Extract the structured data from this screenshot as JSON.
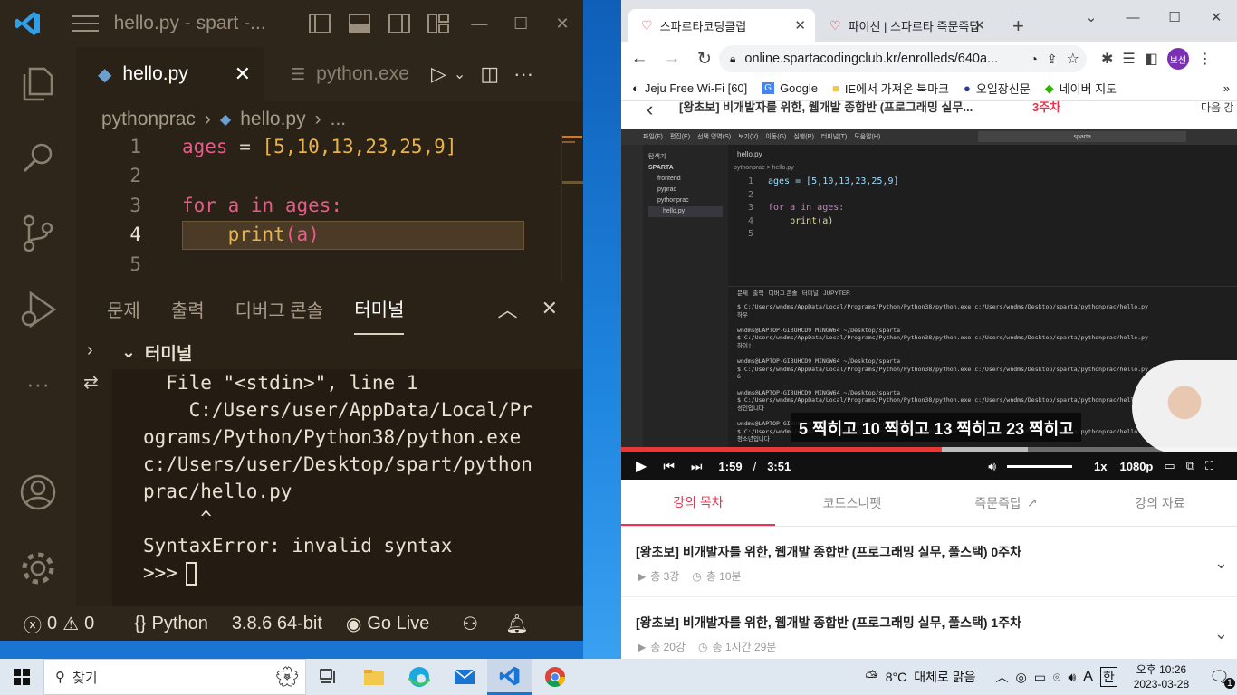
{
  "vscode": {
    "title": "hello.py - spart -...",
    "tabs": {
      "active": "hello.py",
      "inactive": "python.exe"
    },
    "breadcrumb": {
      "folder": "pythonprac",
      "file": "hello.py",
      "more": "..."
    },
    "editor": {
      "line_numbers": [
        "1",
        "2",
        "3",
        "4",
        "5"
      ],
      "line1": {
        "var": "ages",
        "eq": " = ",
        "open": "[",
        "nums": "5,10,13,23,25,9",
        "close": "]"
      },
      "line3": {
        "kw_for": "for",
        "var": " a ",
        "kw_in": "in",
        "rest": " ages:"
      },
      "line4": {
        "indent": "    ",
        "fn": "print",
        "open": "(",
        "arg": "a",
        "close": ")"
      }
    },
    "panel_tabs": [
      "문제",
      "출력",
      "디버그 콘솔",
      "터미널"
    ],
    "terminal_header": "터미널",
    "terminal_lines": [
      "  File \"<stdin>\", line 1",
      "    C:/Users/user/AppData/Local/Pr",
      "ograms/Python/Python38/python.exe",
      "c:/Users/user/Desktop/spart/python",
      "prac/hello.py",
      "     ^",
      "SyntaxError: invalid syntax",
      ">>> "
    ],
    "status": {
      "errors": "0",
      "warnings": "0",
      "language": "Python",
      "version": "3.8.6 64-bit",
      "golive": "Go Live"
    }
  },
  "chrome": {
    "tab1_title": "스파르타코딩클럽",
    "tab2_title": "파이선 | 스파르타 즉문즉답",
    "url": "online.spartacodingclub.kr/enrolleds/640a...",
    "profile_label": "보선",
    "bookmarks": [
      "Jeju Free Wi-Fi [60]",
      "Google",
      "IE에서 가져온 북마크",
      "오일장신문",
      "네이버 지도"
    ],
    "page_top_title": "[왕초보] 비개발자를 위한, 웹개발 종합반 (프로그래밍 실무...",
    "page_top_week": "3주차",
    "page_top_right": "다음 강",
    "video": {
      "subtitle": "5 찍히고 10 찍히고 13 찍히고 23 찍히고",
      "current_time": "1:59",
      "separator": "/",
      "duration": "3:51",
      "progress": 0.52,
      "buffered": 0.66,
      "speed": "1x",
      "quality": "1080p",
      "inner_menu": [
        "파일(F)",
        "편집(E)",
        "선택 영역(S)",
        "보기(V)",
        "이동(G)",
        "실행(R)",
        "터미널(T)",
        "도움말(H)"
      ],
      "inner_search": "sparta",
      "inner_explorer": [
        "탐색기",
        "SPARTA",
        "frontend",
        "pyprac",
        "pythonprac",
        "hello.py"
      ],
      "inner_tab": "hello.py",
      "inner_breadcrumb": "pythonprac > hello.py",
      "inner_code": [
        "ages = [5,10,13,23,25,9]",
        "",
        "for a in ages:",
        "    print(a)",
        ""
      ],
      "inner_panel_tabs": "문제   출력   디버그 콘솔   터미널   JUPYTER",
      "inner_terminal": "$ C:/Users/wndms/AppData/Local/Programs/Python/Python38/python.exe c:/Users/wndms/Desktop/sparta/pythonprac/hello.py\n하우\n\nwndms@LAPTOP-GI3UHCD9 MINGW64 ~/Desktop/sparta\n$ C:/Users/wndms/AppData/Local/Programs/Python/Python38/python.exe c:/Users/wndms/Desktop/sparta/pythonprac/hello.py\n하이!\n\nwndms@LAPTOP-GI3UHCD9 MINGW64 ~/Desktop/sparta\n$ C:/Users/wndms/AppData/Local/Programs/Python/Python38/python.exe c:/Users/wndms/Desktop/sparta/pythonprac/hello.py\n6\n\nwndms@LAPTOP-GI3UHCD9 MINGW64 ~/Desktop/sparta\n$ C:/Users/wndms/AppData/Local/Programs/Python/Python38/python.exe c:/Users/wndms/Desktop/sparta/pythonprac/hello.py\n성인입니다\n\nwndms@LAPTOP-GI3UHCD9 MINGW64 ~/Desktop/sparta\n$ C:/Users/wndms/AppData/Local/Programs/Python/Python38/python.exe c:/Users/wndms/Desktop/sparta/pythonprac/hello.py\n청소년입니다"
    },
    "lecture_tabs": [
      "강의 목차",
      "코드스니펫",
      "즉문즉답",
      "강의 자료"
    ],
    "weeks": [
      {
        "title": "[왕초보] 비개발자를 위한, 웹개발 종합반 (프로그래밍 실무, 풀스택) 0주차",
        "lessons": "총 3강",
        "time": "총 10분"
      },
      {
        "title": "[왕초보] 비개발자를 위한, 웹개발 종합반 (프로그래밍 실무, 풀스택) 1주차",
        "lessons": "총 20강",
        "time": "총 1시간 29분"
      }
    ]
  },
  "taskbar": {
    "search_placeholder": "찾기",
    "weather_temp": "8°C",
    "weather_desc": "대체로 맑음",
    "ime": "A",
    "lang": "한",
    "time": "오후 10:26",
    "date": "2023-03-28",
    "notifications": "1"
  },
  "colors": {
    "vscode_bg": "#2a2117",
    "accent_red": "#e8344e",
    "vs_blue": "#1a74d1"
  }
}
